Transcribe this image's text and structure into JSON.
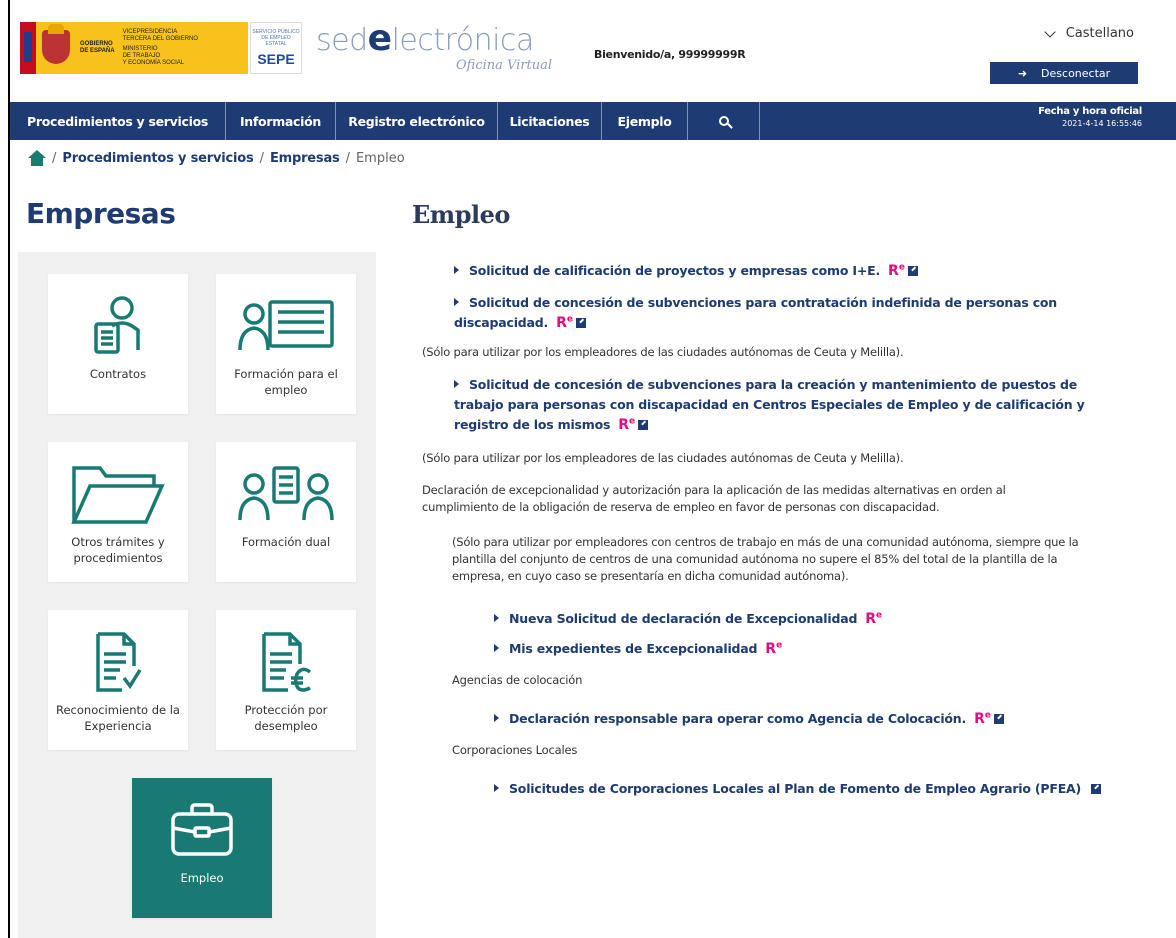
{
  "header": {
    "gob_lines": [
      "VICEPRESIDENCIA",
      "TERCERA DEL GOBIERNO",
      "MINISTERIO",
      "DE TRABAJO",
      "Y ECONOMÍA SOCIAL"
    ],
    "gob_left": [
      "GOBIERNO",
      "DE ESPAÑA"
    ],
    "sepe_small": "SERVICIO PÚBLICO DE EMPLEO ESTATAL",
    "sepe_big": "SEPE",
    "sede_pre": "sed",
    "sede_e": "e",
    "sede_post": "lectrónica",
    "sede_sub": "Oficina Virtual",
    "welcome": "Bienvenido/a, 99999999R",
    "language": "Castellano",
    "logout": "Desconectar"
  },
  "nav": {
    "items": [
      {
        "label": "Procedimientos y servicios"
      },
      {
        "label": "Información"
      },
      {
        "label": "Registro electrónico"
      },
      {
        "label": "Licitaciones"
      },
      {
        "label": "Ejemplo"
      }
    ],
    "time_label": "Fecha y hora oficial",
    "time_value": "2021-4-14 16:55:46"
  },
  "breadcrumb": {
    "sep": "/",
    "items": [
      "Procedimientos y servicios",
      "Empresas"
    ],
    "current": "Empleo"
  },
  "left": {
    "title": "Empresas",
    "cards": [
      {
        "label": "Contratos",
        "icon": "contract-person-icon"
      },
      {
        "label": "Formación para el empleo",
        "icon": "training-board-icon"
      },
      {
        "label": "Otros trámites y procedimientos",
        "icon": "folder-icon"
      },
      {
        "label": "Formación dual",
        "icon": "dual-training-icon"
      },
      {
        "label": "Reconocimiento de la Experiencia",
        "icon": "document-check-icon"
      },
      {
        "label": "Protección por desempleo",
        "icon": "document-euro-icon"
      },
      {
        "label": "Empleo",
        "icon": "briefcase-icon"
      }
    ]
  },
  "main": {
    "title": "Empleo",
    "re_label": "R",
    "re_sup": "e",
    "links": [
      "Solicitud de calificación de proyectos y empresas como I+E.",
      "Solicitud de concesión de subvenciones para contratación indefinida de personas con discapacidad.",
      "Solicitud de concesión de subvenciones para la creación y mantenimiento de puestos de trabajo para personas con discapacidad en Centros Especiales de Empleo y de calificación y registro de los mismos",
      "Nueva Solicitud de declaración de Excepcionalidad",
      "Mis expedientes de Excepcionalidad",
      "Declaración responsable para operar como Agencia de Colocación.",
      "Solicitudes de Corporaciones Locales al Plan de Fomento de Empleo Agrario (PFEA)"
    ],
    "note_ceuta": "(Sólo para utilizar por los empleadores de las ciudades autónomas de Ceuta y Melilla).",
    "declaracion": "Declaración de excepcionalidad y autorización para la aplicación de las medidas alternativas en orden al cumplimiento de la obligación de reserva de empleo en favor de personas con discapacidad.",
    "note_varias": "(Sólo para utilizar por empleadores con centros de trabajo en más de una comunidad autónoma, siempre que la plantilla del conjunto de centros de una comunidad autónoma no supere el 85% del total de la plantilla de la empresa, en cuyo caso se presentaría en dicha comunidad autónoma).",
    "agencias": "Agencias de colocación",
    "corporaciones": "Corporaciones Locales"
  },
  "colors": {
    "navy": "#1f3b73",
    "teal": "#187a72",
    "re_pink": "#e40d7d"
  }
}
